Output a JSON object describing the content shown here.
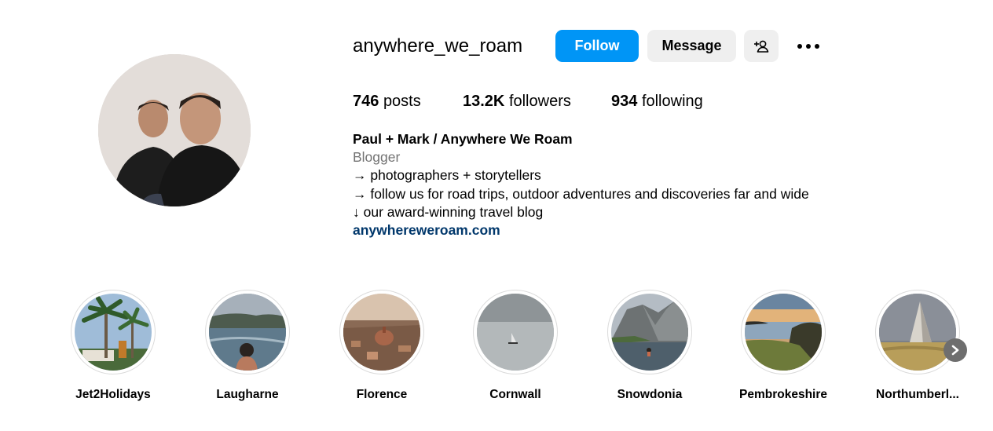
{
  "profile": {
    "username": "anywhere_we_roam",
    "avatar_icon": "profile-photo"
  },
  "actions": {
    "follow_label": "Follow",
    "message_label": "Message",
    "suggest_icon": "add-person-icon",
    "more_icon": "more-options-icon"
  },
  "stats": {
    "posts_count": "746",
    "posts_label": "posts",
    "followers_count": "13.2K",
    "followers_label": "followers",
    "following_count": "934",
    "following_label": "following"
  },
  "bio": {
    "name": "Paul + Mark / Anywhere We Roam",
    "category": "Blogger",
    "lines": [
      "→ photographers + storytellers",
      "→ follow us for road trips, outdoor adventures and discoveries far and wide",
      "↓ our award-winning travel blog"
    ],
    "link": "anywhereweroam.com"
  },
  "highlights": [
    {
      "label": "Jet2Holidays"
    },
    {
      "label": "Laugharne"
    },
    {
      "label": "Florence"
    },
    {
      "label": "Cornwall"
    },
    {
      "label": "Snowdonia"
    },
    {
      "label": "Pembrokeshire"
    },
    {
      "label": "Northumberl..."
    }
  ],
  "colors": {
    "follow_button": "#0095f6",
    "secondary_button": "#efefef",
    "category_text": "#737373",
    "link_text": "#00376b"
  }
}
